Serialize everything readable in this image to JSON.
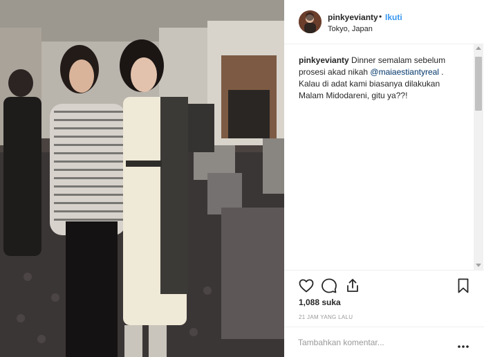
{
  "post": {
    "username": "pinkyevianty",
    "separator": "•",
    "follow_label": "Ikuti",
    "location": "Tokyo, Japan"
  },
  "caption": {
    "username": "pinkyevianty",
    "text_before": " Dinner semalam sebelum prosesi akad nikah ",
    "mention": "@maiaestiantyreal",
    "text_after": " . Kalau di adat kami biasanya dilakukan Malam Midodareni, gitu ya??!"
  },
  "stats": {
    "likes": "1,088 suka",
    "time_ago": "21 JAM YANG LALU"
  },
  "comment": {
    "placeholder": "Tambahkan komentar..."
  },
  "icons": {
    "like": "heart-icon",
    "comment": "comment-icon",
    "share": "share-icon",
    "save": "bookmark-icon",
    "more": "more-dots-icon"
  },
  "colors": {
    "link_blue": "#3897f0",
    "mention_blue": "#003569",
    "muted_gray": "#999999",
    "text": "#262626"
  }
}
